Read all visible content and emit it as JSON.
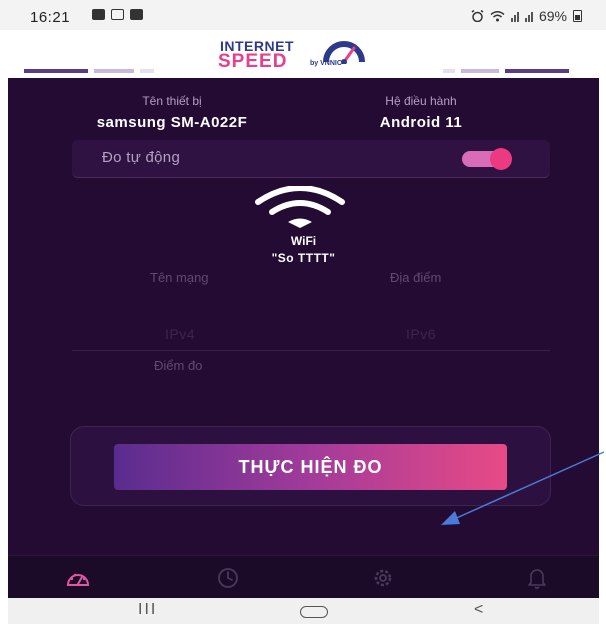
{
  "status_bar": {
    "time": "16:21",
    "battery": "69%"
  },
  "header": {
    "logo_line1": "INTERNET",
    "logo_line2": "SPEED",
    "logo_by": "by VNNIC"
  },
  "device": {
    "name_label": "Tên thiết bị",
    "name_value": "samsung SM-A022F",
    "os_label": "Hệ điều hành",
    "os_value": "Android 11"
  },
  "auto_measure": {
    "label": "Đo tự động",
    "enabled": true
  },
  "connection": {
    "type": "WiFi",
    "network_name": "\"So TTTT\"",
    "network_label": "Tên mạng",
    "location_label": "Địa điểm",
    "ipv4_label": "IPv4",
    "ipv6_label": "IPv6",
    "point_label": "Điểm đo"
  },
  "action": {
    "label": "THỰC HIỆN ĐO"
  },
  "bottom_nav": {
    "items": [
      "speedometer-icon",
      "history-clock-icon",
      "settings-gear-icon",
      "notification-bell-icon"
    ],
    "active": "speedometer-icon"
  },
  "system_nav": {
    "recent": "III",
    "back": "<"
  },
  "colors": {
    "background": "#240b33",
    "accent_pink": "#e83e8c",
    "accent_blue": "#2d3a8c",
    "button_gradient_start": "#5a2c8f",
    "button_gradient_end": "#e84a86"
  }
}
